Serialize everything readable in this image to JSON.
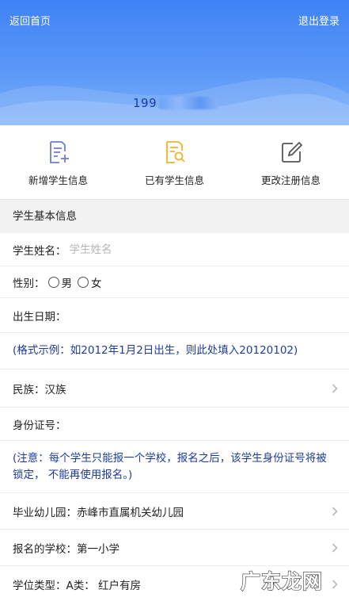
{
  "header": {
    "back_label": "返回首页",
    "logout_label": "退出登录",
    "phone_visible": "199"
  },
  "actions": [
    {
      "label": "新增学生信息",
      "icon": "add-document-icon",
      "color": "#6f7bd8"
    },
    {
      "label": "已有学生信息",
      "icon": "search-document-icon",
      "color": "#f0b429"
    },
    {
      "label": "更改注册信息",
      "icon": "edit-icon",
      "color": "#555555"
    }
  ],
  "section": {
    "title": "学生基本信息"
  },
  "form": {
    "name_label": "学生姓名：",
    "name_placeholder": "学生姓名",
    "gender_label": "性别：",
    "gender_male": "男",
    "gender_female": "女",
    "dob_label": "出生日期：",
    "dob_note": "(格式示例：如2012年1月2日出生，则此处填入20120102)",
    "ethnicity_label": "民族：",
    "ethnicity_value": "汉族",
    "id_label": "身份证号：",
    "id_note": "(注意：每个学生只能报一个学校，报名之后，该学生身份证号将被锁定，  不能再使用报名。)",
    "kindergarten_label": "毕业幼儿园：",
    "kindergarten_value": "赤峰市直属机关幼儿园",
    "school_label": "报名的学校：",
    "school_value": "第一小学",
    "degree_label": "学位类型：",
    "degree_value": "A类：  红户有房"
  },
  "watermark": {
    "text": "广东龙网"
  },
  "colors": {
    "header_blue": "#3f82f5",
    "note_blue": "#1e3c9e",
    "section_bg": "#f2f2f2"
  }
}
